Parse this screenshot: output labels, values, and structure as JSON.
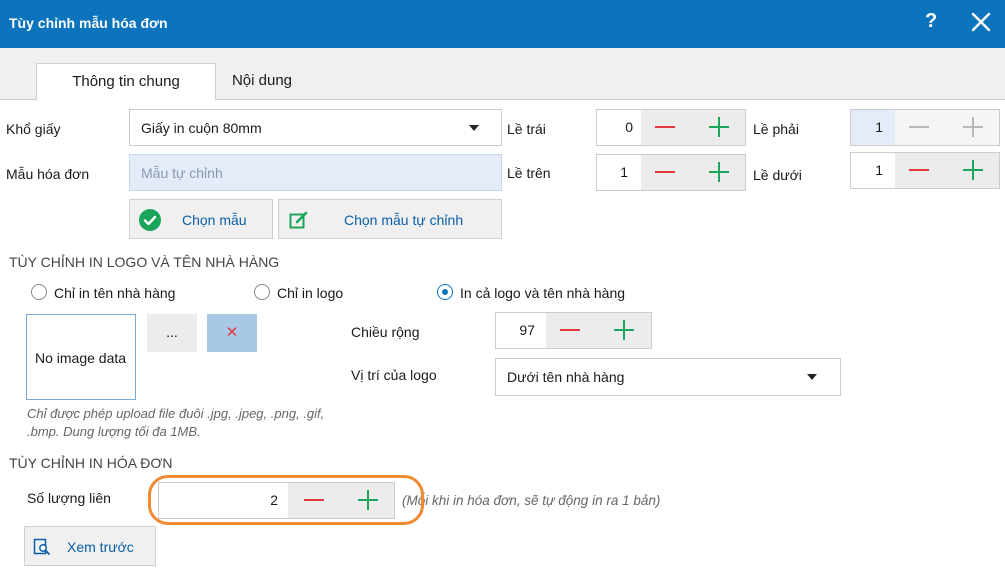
{
  "window": {
    "title": "Tùy chỉnh mẫu hóa đơn",
    "help": "?"
  },
  "tabs": [
    {
      "label": "Thông tin chung",
      "active": true
    },
    {
      "label": "Nội dung",
      "active": false
    }
  ],
  "paper": {
    "label": "Khổ giấy",
    "value": "Giấy in cuộn 80mm"
  },
  "template": {
    "label": "Mẫu hóa đơn",
    "placeholder": "Mẫu tự chỉnh"
  },
  "margins": {
    "left": {
      "label": "Lề trái",
      "value": "0"
    },
    "top": {
      "label": "Lề trên",
      "value": "1"
    },
    "right": {
      "label": "Lề phải",
      "value": "1"
    },
    "bottom": {
      "label": "Lề dưới",
      "value": "1"
    }
  },
  "buttons": {
    "choose_template": "Chọn mẫu",
    "choose_custom": "Chọn mẫu tự chỉnh",
    "preview": "Xem trước",
    "browse": "...",
    "remove": "✕"
  },
  "logo_section": {
    "title": "TÙY CHỈNH IN LOGO VÀ TÊN NHÀ HÀNG",
    "options": [
      {
        "label": "Chỉ in tên nhà hàng",
        "checked": false
      },
      {
        "label": "Chỉ in logo",
        "checked": false
      },
      {
        "label": "In cả logo và tên nhà hàng",
        "checked": true
      }
    ],
    "image_placeholder": "No image data",
    "width_label": "Chiều rộng",
    "width_value": "97",
    "position_label": "Vị trí của logo",
    "position_value": "Dưới tên nhà hàng",
    "note_line1": "Chỉ được phép upload file đuôi  .jpg, .jpeg, .png, .gif,",
    "note_line2": ".bmp. Dung lượng tối đa 1MB."
  },
  "invoice_section": {
    "title": "TÙY CHỈNH IN HÓA ĐƠN",
    "copies_label": "Số lượng liên",
    "copies_value": "2",
    "copies_note": "(Mỗi khi in hóa đơn, sẽ tự động in ra 1 bản)"
  },
  "colors": {
    "titlebar": "#0b74bd",
    "minus": "#e2393f",
    "plus": "#1aa55a",
    "highlight": "#f08a33"
  }
}
